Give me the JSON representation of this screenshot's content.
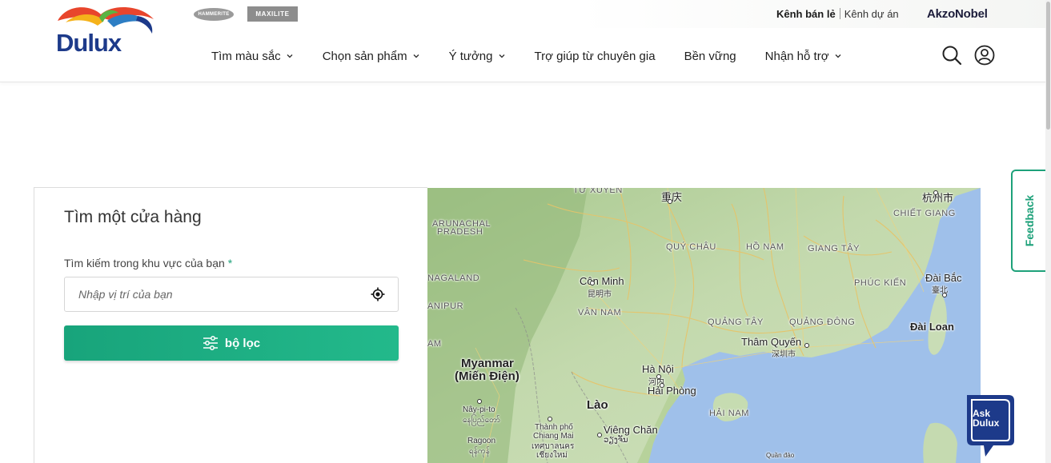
{
  "header": {
    "logo_text": "Dulux",
    "brands": [
      "HAMMERITE",
      "MAXILITE"
    ],
    "util_links": {
      "retail": "Kênh bán lẻ",
      "project": "Kênh dự án"
    },
    "corporate": "AkzoNobel",
    "nav": [
      {
        "label": "Tìm màu sắc",
        "has_dropdown": true
      },
      {
        "label": "Chọn sản phẩm",
        "has_dropdown": true
      },
      {
        "label": "Ý tưởng",
        "has_dropdown": true
      },
      {
        "label": "Trợ giúp từ chuyên gia",
        "has_dropdown": false
      },
      {
        "label": "Bền vững",
        "has_dropdown": false
      },
      {
        "label": "Nhận hỗ trợ",
        "has_dropdown": true
      }
    ],
    "icons": [
      "search-icon",
      "user-icon"
    ]
  },
  "store_finder": {
    "title": "Tìm một cửa hàng",
    "field_label": "Tìm kiếm trong khu vực của bạn",
    "required_mark": "*",
    "placeholder": "Nhập vị trí của bạn",
    "filter_label": "bộ lọc"
  },
  "map": {
    "labels": {
      "tu_xuyen": "TỨ XUYÊN",
      "trung_khanh": "重庆",
      "hang_chau": "杭州市",
      "arunachal": "ARUNACHAL",
      "pradesh": "PRADESH",
      "chiet_giang": "CHIẾT GIANG",
      "quy_chau": "QUÝ CHÂU",
      "ho_nam": "HỒ NAM",
      "giang_tay": "GIANG TÂY",
      "nagaland": "NAGALAND",
      "con_minh": "Côn Minh",
      "con_minh_cn": "昆明市",
      "phuc_kien": "PHÚC KIẾN",
      "dai_bac": "Đài Bắc",
      "dai_bac_cn": "臺北",
      "manipur": "ANIPUR",
      "van_nam": "VÂN NAM",
      "quang_tay": "QUẢNG TÂY",
      "quang_dong": "QUẢNG ĐÔNG",
      "dai_loan": "Đài Loan",
      "am": "AM",
      "tham_quyen": "Thâm Quyến",
      "tham_quyen_cn": "深圳市",
      "myanmar": "Myanmar",
      "mien_dien": "(Miến Điện)",
      "ha_noi": "Hà Nội",
      "ha_noi_cn": "河内",
      "hai_phong": "Hải Phòng",
      "nay_pi_to": "Nây-pi-to",
      "nay_pi_to_native": "နေပြည်တော်",
      "lao": "Lào",
      "hai_nam": "HẢI NAM",
      "thanh_pho": "Thành phố",
      "chiang_mai": "Chiang Mai",
      "chiang_mai_th": "เทศบาลนคร",
      "chiang_mai_th2": "เชียงใหม่",
      "vieng_chan": "Viêng Chăn",
      "vieng_chan_lo": "ວຽງຈັນ",
      "rangoon": "Ragoon",
      "rangoon_native": "ရန်ကုန်",
      "quan_dao": "Quần đảo"
    }
  },
  "feedback_label": "Feedback",
  "ask": {
    "line1": "Ask",
    "line2": "Dulux"
  },
  "colors": {
    "accent": "#1ea17a",
    "navy": "#1d3a8a",
    "map_water": "#9fbfe9",
    "map_land": "#b9d3a1"
  }
}
